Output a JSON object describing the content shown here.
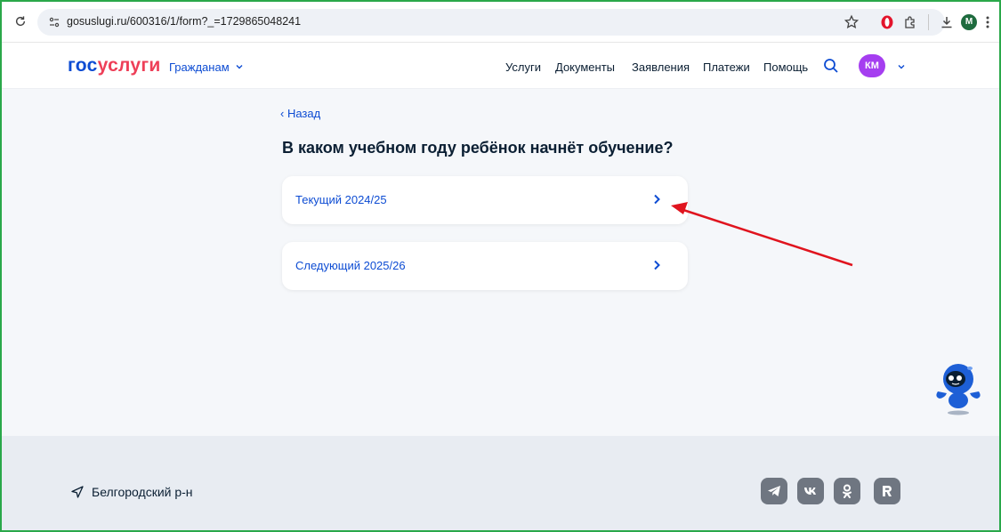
{
  "browser": {
    "url": "gosuslugi.ru/600316/1/form?_=1729865048241",
    "profile_initial": "M",
    "icons": [
      "reload-icon",
      "site-info-icon",
      "bookmark-star-icon",
      "opera-icon",
      "extensions-icon",
      "downloads-icon",
      "profile-icon",
      "more-icon"
    ]
  },
  "header": {
    "logo_part1": "гос",
    "logo_part2": "услуги",
    "citizens_label": "Гражданам",
    "nav": {
      "services": "Услуги",
      "documents": "Документы",
      "applications": "Заявления",
      "payments": "Платежи",
      "help": "Помощь"
    },
    "avatar_initials": "КМ"
  },
  "main": {
    "back_label": "‹ Назад",
    "question": "В каком учебном году ребёнок начнёт обучение?",
    "options": [
      {
        "label": "Текущий 2024/25"
      },
      {
        "label": "Следующий 2025/26"
      }
    ]
  },
  "footer": {
    "region": "Белгородский р-н",
    "social": [
      "telegram-icon",
      "vk-icon",
      "odnoklassniki-icon",
      "rutube-icon"
    ]
  },
  "colors": {
    "brand_blue": "#0d4cd3",
    "brand_red": "#ee3f58",
    "avatar": "#a53ef0",
    "annotation_arrow": "#e0141e",
    "frame_border": "#2aa84a"
  }
}
